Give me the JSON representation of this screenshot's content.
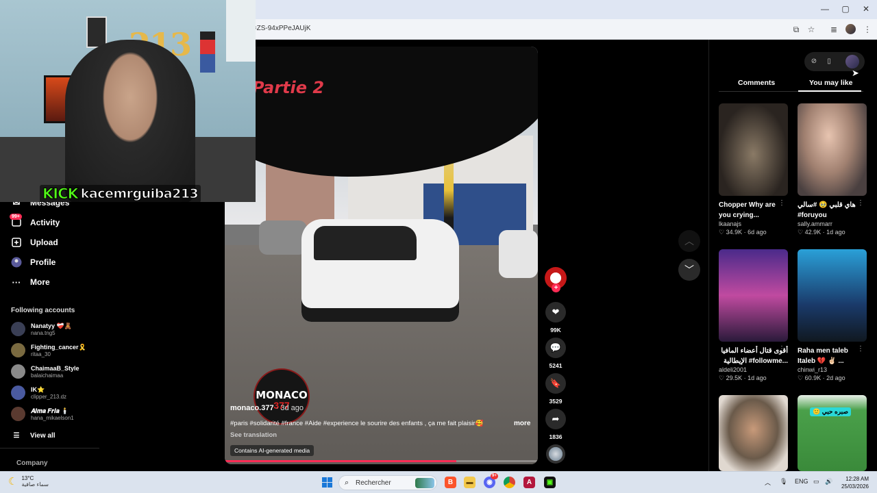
{
  "browser": {
    "url": "t=ZS-94xPPeJAUjK",
    "window_buttons": [
      "—",
      "▢",
      "✕"
    ]
  },
  "webcam": {
    "kick_label": "KICK",
    "streamer": "kacemrguiba213",
    "balloon_text": "213"
  },
  "sidebar": {
    "partial_item": "Messages",
    "items": [
      {
        "label": "Activity",
        "icon": "activity-icon",
        "badge": "99+"
      },
      {
        "label": "Upload",
        "icon": "upload-icon"
      },
      {
        "label": "Profile",
        "icon": "profile-icon"
      },
      {
        "label": "More",
        "icon": "more-icon"
      }
    ],
    "following_title": "Following accounts",
    "accounts": [
      {
        "name": "Nanatyy ❤️‍🩹🧸",
        "handle": "nana.tng5",
        "color": "#3a3f55"
      },
      {
        "name": "Fighting_cancer🎗️",
        "handle": "ritaa_30",
        "color": "#7a6a40"
      },
      {
        "name": "ChaimaaB_Style",
        "handle": "balaichaimaa",
        "color": "#8a8a8a"
      },
      {
        "name": "IK⭐",
        "handle": "clipper_213.dz",
        "color": "#4a5aa0"
      },
      {
        "name": "𝑨𝒍𝒎𝒂 𝑭𝒓𝒊𝒂 🕯️",
        "handle": "hana_mikaelson1",
        "color": "#5a3a30"
      }
    ],
    "view_all": "View all",
    "company": "Company"
  },
  "video": {
    "part_title": "Partie 2",
    "logo_text": "MONACO",
    "logo_number": "377",
    "author": "monaco.377",
    "age": " · 3d ago",
    "description": "#paris #solidarité #france #Aide #experience  le sourire des   enfants , ça me fait plaisir🥰",
    "more": "more",
    "see_translation": "See translation",
    "ai_notice": "Contains AI-generated media",
    "progress": 0.74
  },
  "actions": {
    "likes": "99K",
    "comments": "5241",
    "saves": "3529",
    "shares": "1836"
  },
  "right_panel": {
    "tabs": [
      "Comments",
      "You may like"
    ],
    "active_tab": "You may like",
    "cards": [
      {
        "title": "Chopper Why are you crying...",
        "author": "lkaanajs",
        "likes": "34.9K",
        "age": "6d ago",
        "thumb": "#3a342e"
      },
      {
        "title": "هاي قلبي 🥹 #سالي #foruyou",
        "author": "sally.ammarr",
        "likes": "42.9K",
        "age": "1d ago",
        "thumb": "#b69a8a"
      },
      {
        "title": "أقوى قتال أعضاء المافيا الإيطالية #followme...",
        "author": "aldeli2001",
        "likes": "29.5K",
        "age": "1d ago",
        "thumb": "#6a3a8a"
      },
      {
        "title": "Raha men taleb Italeb 💔 ✌🏻 ...",
        "author": "chinwi_r13",
        "likes": "60.9K",
        "age": "2d ago",
        "thumb": "#1a5a8a"
      },
      {
        "title": "",
        "author": "",
        "likes": "",
        "age": "",
        "thumb": "#8a7060"
      },
      {
        "title": "",
        "author": "",
        "likes": "",
        "age": "",
        "thumb": "#3a8a4a"
      }
    ],
    "card6_overlay": "🙂 صبره حبي"
  },
  "taskbar": {
    "temp": "13°C",
    "weather": "سماء صافية",
    "search_placeholder": "Rechercher",
    "lang": "ENG",
    "time": "12:28 AM",
    "date": "25/03/2026",
    "discord_badge": "9+"
  }
}
